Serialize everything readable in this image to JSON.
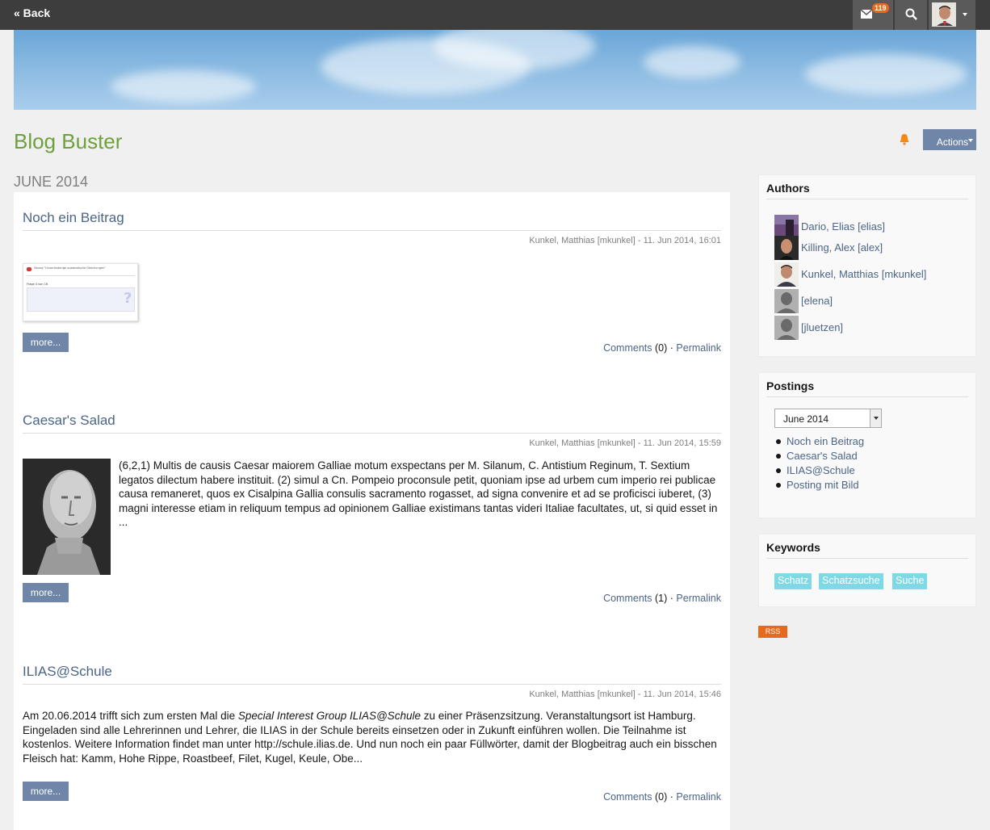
{
  "topbar": {
    "back_label": "« Back",
    "mail_count": "119",
    "icons": [
      "envelope-icon",
      "search-icon",
      "user-avatar",
      "chevron-down-icon"
    ]
  },
  "header": {
    "title": "Blog Buster",
    "actions_label": "Actions",
    "notification_icon": "bell-icon",
    "title_color": "#6ea03c",
    "accent_color": "#6f86a8"
  },
  "month_heading": "JUNE 2014",
  "posts": [
    {
      "title": "Noch ein Beitrag",
      "meta": "Kunkel, Matthias [mkunkel] - 11. Jun 2014, 16:01",
      "more_label": "more...",
      "comments_label": "Comments",
      "comments_count": "(0)",
      "separator": "·",
      "permalink_label": "Permalink",
      "thumbnail_title": "Übung \"Unveränderige quadratische Gleichungen\"",
      "thumbnail_page": "Frage 4 von 16"
    },
    {
      "title": "Caesar's Salad",
      "meta": "Kunkel, Matthias [mkunkel] - 11. Jun 2014, 15:59",
      "text": "(6,2,1) Multis de causis Caesar maiorem Galliae motum exspectans per M. Silanum, C. Antistium Reginum, T. Sextium legatos dilectum habere instituit. (2) simul a Cn. Pompeio proconsule petit, quoniam ipse ad urbem cum imperio rei publicae causa remaneret, quos ex Cisalpina Gallia consulis sacramento rogasset, ad signa convenire et ad se proficisci iuberet, (3) magni interesse etiam in reliquum tempus ad opinionem Galliae existimans tantas videri Italiae facultates, ut, si quid esset in ...",
      "more_label": "more...",
      "comments_label": "Comments",
      "comments_count": "(1)",
      "separator": "·",
      "permalink_label": "Permalink"
    },
    {
      "title": "ILIAS@Schule",
      "meta": "Kunkel, Matthias [mkunkel] - 11. Jun 2014, 15:46",
      "text_before": "Am 20.06.2014 trifft sich zum ersten Mal die ",
      "text_italic": "Special Interest Group ILIAS@Schule",
      "text_after": " zu einer Präsenzsitzung. Veranstaltungsort ist Hamburg. Eingeladen sind alle Lehrerinnen und Lehrer, die ILIAS in der Schule bereits einsetzen oder in Zukunft einführen wollen. Die Teilnahme ist kostenlos. Weitere Information findet man unter http://schule.ilias.de. Und nun noch ein paar Füllwörter, damit der Blogbeitrag auch ein bisschen Fleisch hat: Kamm, Hohe Rippe, Roastbeef, Filet, Kugel, Keule, Obe...",
      "more_label": "more...",
      "comments_label": "Comments",
      "comments_count": "(0)",
      "separator": "·",
      "permalink_label": "Permalink"
    }
  ],
  "sidebar": {
    "authors_title": "Authors",
    "authors": [
      {
        "name": "Dario, Elias [elias]"
      },
      {
        "name": "Killing, Alex [alex]"
      },
      {
        "name": "Kunkel, Matthias [mkunkel]"
      },
      {
        "name": "[elena]"
      },
      {
        "name": "[jluetzen]"
      }
    ],
    "postings_title": "Postings",
    "month_select": "June 2014",
    "postings": [
      "Noch ein Beitrag",
      "Caesar's Salad",
      "ILIAS@Schule",
      "Posting mit Bild"
    ],
    "keywords_title": "Keywords",
    "keywords": [
      "Schatz",
      "Schatzsuche",
      "Suche"
    ],
    "rss_label": "RSS"
  }
}
